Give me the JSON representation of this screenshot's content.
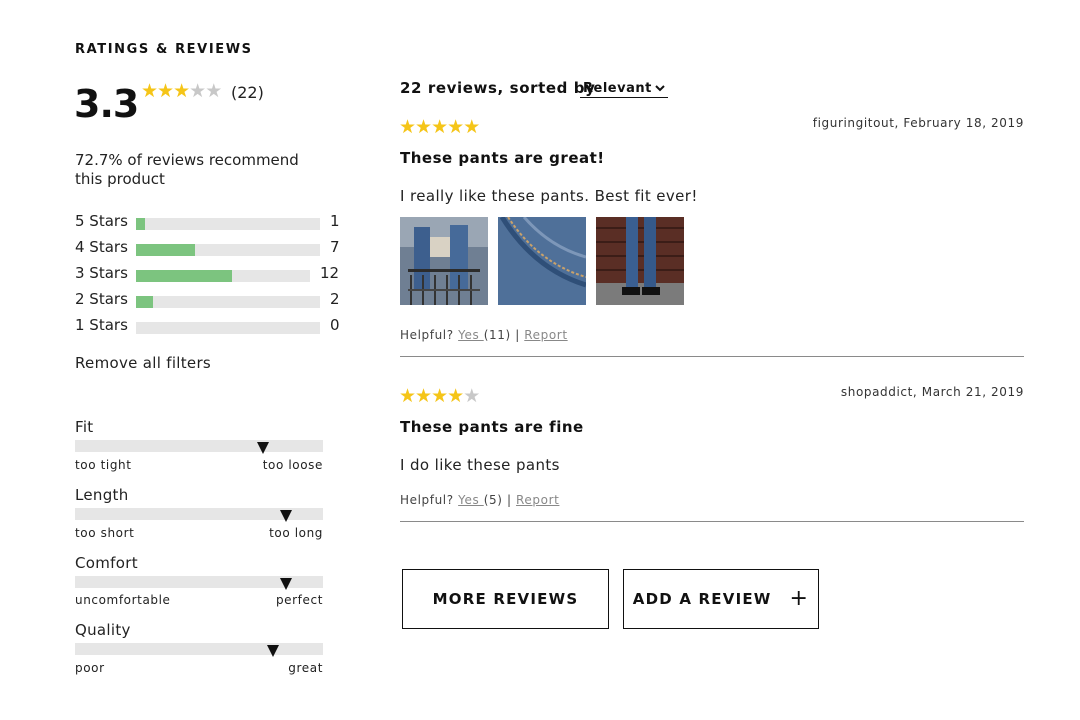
{
  "section_title": "RATINGS & REVIEWS",
  "summary": {
    "average": "3.3",
    "average_value": 3.3,
    "count_label": "(22)",
    "recommend_text": "72.7% of reviews recommend this product"
  },
  "distribution": [
    {
      "label": "5 Stars",
      "count": "1",
      "fraction": 0.05
    },
    {
      "label": "4 Stars",
      "count": "7",
      "fraction": 0.32
    },
    {
      "label": "3 Stars",
      "count": "12",
      "fraction": 0.55
    },
    {
      "label": "2 Stars",
      "count": "2",
      "fraction": 0.09
    },
    {
      "label": "1 Stars",
      "count": "0",
      "fraction": 0
    }
  ],
  "remove_filters": "Remove all filters",
  "attributes": [
    {
      "name": "Fit",
      "low": "too tight",
      "high": "too loose",
      "level": 0.76
    },
    {
      "name": "Length",
      "low": "too short",
      "high": "too long",
      "level": 0.85
    },
    {
      "name": "Comfort",
      "low": "uncomfortable",
      "high": "perfect",
      "level": 0.85
    },
    {
      "name": "Quality",
      "low": "poor",
      "high": "great",
      "level": 0.8
    }
  ],
  "reviews_header": {
    "summary": "22 reviews, sorted by",
    "sort_value": "Relevant"
  },
  "reviews": [
    {
      "rating": 5,
      "author_date": "figuringitout, February 18, 2019",
      "title": "These pants are great!",
      "body": "I really like these pants. Best fit ever!",
      "helpful_prefix": "Helpful?",
      "yes_label": "Yes ",
      "yes_count": "(11)",
      "separator": "|",
      "report_label": "Report"
    },
    {
      "rating": 4,
      "author_date": "shopaddict, March 21, 2019",
      "title": "These pants are fine",
      "body": "I do like these pants",
      "helpful_prefix": "Helpful?",
      "yes_label": "Yes ",
      "yes_count": "(5)",
      "separator": "|",
      "report_label": "Report"
    }
  ],
  "buttons": {
    "more_reviews": "MORE REVIEWS",
    "add_review": "ADD A REVIEW",
    "add_icon": "+"
  },
  "colors": {
    "star": "#f5c518",
    "bar_fill": "#7cc47f",
    "track": "#e6e6e6"
  }
}
